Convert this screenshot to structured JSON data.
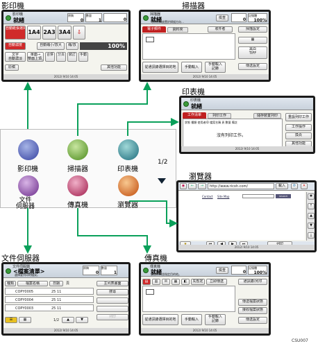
{
  "labels": {
    "copier": "影印機",
    "scanner": "掃描器",
    "printer": "印表機",
    "browser": "瀏覽器",
    "doc_server": "文件伺服器",
    "fax": "傳真機"
  },
  "home": {
    "icons": [
      "影印機",
      "掃描器",
      "印表機",
      "文件\n伺服器",
      "傳真機",
      "瀏覽器"
    ],
    "page": "1/2"
  },
  "copier_screen": {
    "title": "影印機",
    "status": "就緒",
    "orig_label": "原稿",
    "orig_val": "0",
    "qty_label": "數量",
    "qty_val": "1",
    "copies_val": "0",
    "auto_paper": "自動紙張選擇",
    "paper_1": "1",
    "paper_2": "2",
    "paper_3": "3",
    "size_a4a": "A4",
    "size_a3": "A3",
    "size_a4b": "A4",
    "auto_density": "自動濃度",
    "auto_reduce": "自動縮小/放大",
    "reduce_enlarge": "縮/放",
    "percent": "100%",
    "text_auto": "文字\n自動濃淡",
    "duplex": "單面→\n雙面上頂上",
    "combine": "合併",
    "sort": "分頁",
    "staple": "裝訂",
    "manual": "手動",
    "special_orig": "原稿",
    "special_fn": "其他功能",
    "footer": "2012/ 9/10    14:05"
  },
  "scanner_screen": {
    "title": "掃描器",
    "status": "就緒",
    "sub": "可將原稿放置於掃描方向…",
    "check": "檢查",
    "mem_label": "記憶體",
    "mem_val": "100%",
    "count_val": "0",
    "tab_email": "電子郵件",
    "tab_folder": "資料夾",
    "manual_input": "手動輸入",
    "hand_input": "手動輸入\n記錄",
    "select_dest": "從通訊錄選擇目的地",
    "scan_settings": "掃描設定",
    "send_settings": "傳送設定",
    "dest_info": "收件者",
    "tiff": "黑白\nTIFF",
    "footer": "2012/ 9/10    14:05"
  },
  "printer_screen": {
    "title": "印表機",
    "status": "就緒",
    "tab_job": "工作清單",
    "tab_print": "列印工作",
    "tab_spool": "儲存裝置列印",
    "cols": "狀態  種類  使用者ID  檔案名稱  頁  數量  備註",
    "empty": "沒有列印工作。",
    "btn_cancel": "重設列印工作",
    "btn_ops": "工作操作",
    "btn_switch": "換頁",
    "btn_other": "其他功能",
    "footer": "2012/ 9/10    14:05"
  },
  "browser_screen": {
    "url": "http://www.ricoh.com/",
    "btn_load": "載入",
    "contact": "Contact",
    "sitemap": "Site Map",
    "search_btn": "SEARCH",
    "print": "列印",
    "footer": "2012/ 9/10    14:05"
  },
  "docserver_screen": {
    "title": "文件伺服器",
    "header": "<檔案清單>",
    "sub": "選擇要列印的檔案。",
    "orig_label": "原稿",
    "orig_val": "0",
    "qty_label": "數量",
    "qty_val": "1",
    "col_type": "種類",
    "col_name": "檔案名稱",
    "col_date": "日期",
    "col_pages": "頁",
    "col_user": "使用者名稱",
    "files": [
      "COPY0005",
      "COPY0004",
      "COPY0003"
    ],
    "dates": [
      "25 11",
      "25 11",
      "25 11"
    ],
    "btn_search": "搜尋",
    "btn_print": "主列表畫面",
    "btn_ops": "列印",
    "page": "1/2",
    "footer": "2012/ 9/10    14:05"
  },
  "fax_screen": {
    "title": "傳真機",
    "status": "就緒",
    "sub": "放置原稿並指定目的地。",
    "check": "檢查",
    "mem_label": "記憶體",
    "mem_val": "100%",
    "count_val": "0",
    "tab_auto": "先暫定",
    "tab_immediate": "立即傳送",
    "addr_label": "通訊錄/列印",
    "select_dest": "從通訊錄選擇目的地",
    "manual_input": "手動輸入",
    "hand_input": "手動輸入\n記錄",
    "fax_settings": "傳送檔案狀態",
    "send_info": "接收檔案狀態",
    "tx_settings": "傳送設定",
    "footer": "2012/ 9/10    14:05"
  },
  "figure_id": "CSU007"
}
